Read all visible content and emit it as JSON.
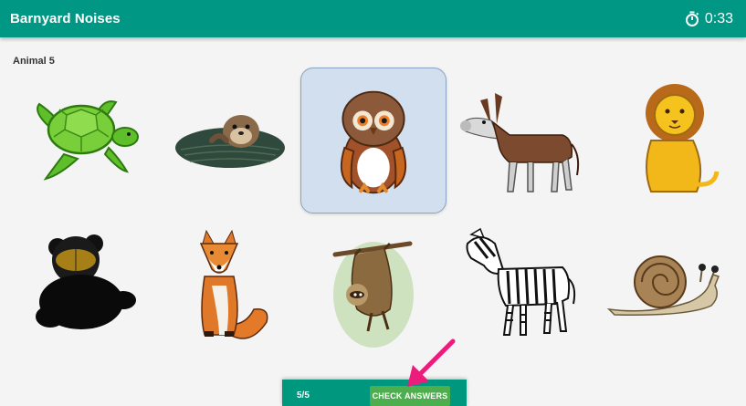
{
  "app": {
    "title": "Barnyard Noises",
    "timer": "0:33"
  },
  "prompt": {
    "label": "Animal 5"
  },
  "animals": [
    {
      "name": "turtle-card"
    },
    {
      "name": "sea-otter-card"
    },
    {
      "name": "owl-card",
      "selected": true
    },
    {
      "name": "donkey-card"
    },
    {
      "name": "lion-card"
    },
    {
      "name": "bear-card"
    },
    {
      "name": "fox-card"
    },
    {
      "name": "sloth-card"
    },
    {
      "name": "zebra-card"
    },
    {
      "name": "snail-card"
    }
  ],
  "footer": {
    "score": "5/5",
    "check_label": "CHECK ANSWERS"
  },
  "colors": {
    "appbar": "#009784",
    "selected_card": "#d2dfef",
    "check_button": "#4cae4c",
    "arrow": "#ec1c7c"
  }
}
